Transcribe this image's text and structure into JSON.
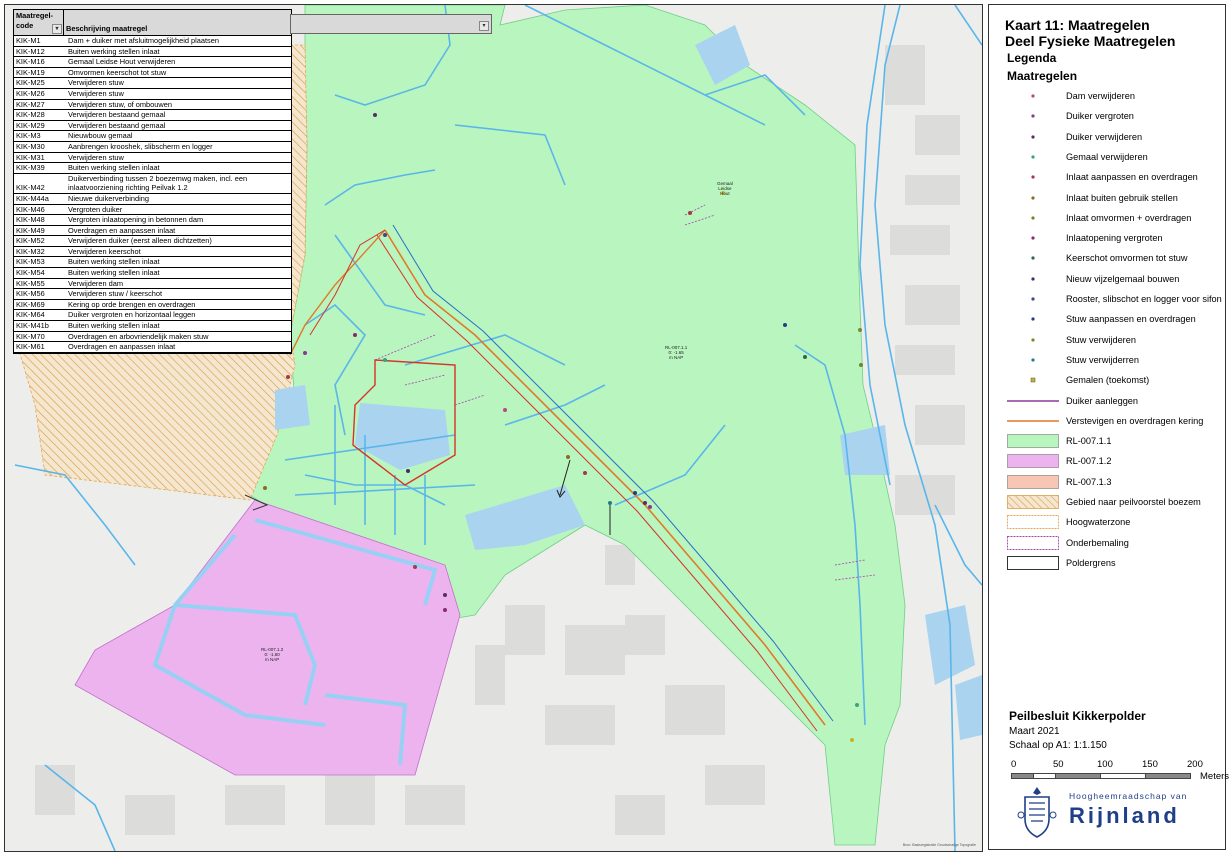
{
  "table": {
    "header_code": "Maatregel-code",
    "header_desc": "Beschrijving maatregel",
    "rows": [
      {
        "code": "KIK-M1",
        "desc": "Dam + duiker met afsluitmogelijkheid plaatsen"
      },
      {
        "code": "KIK-M12",
        "desc": "Buiten werking stellen inlaat"
      },
      {
        "code": "KIK-M16",
        "desc": "Gemaal Leidse Hout verwijderen"
      },
      {
        "code": "KIK-M19",
        "desc": "Omvormen keerschot tot stuw"
      },
      {
        "code": "KIK-M25",
        "desc": "Verwijderen stuw"
      },
      {
        "code": "KIK-M26",
        "desc": "Verwijderen stuw"
      },
      {
        "code": "KIK-M27",
        "desc": "Verwijderen stuw, of ombouwen"
      },
      {
        "code": "KIK-M28",
        "desc": "Verwijderen bestaand gemaal"
      },
      {
        "code": "KIK-M29",
        "desc": "Verwijderen bestaand gemaal"
      },
      {
        "code": "KIK-M3",
        "desc": "Nieuwbouw gemaal"
      },
      {
        "code": "KIK-M30",
        "desc": "Aanbrengen krooshek, slibscherm en logger"
      },
      {
        "code": "KIK-M31",
        "desc": "Verwijderen stuw"
      },
      {
        "code": "KIK-M39",
        "desc": "Buiten werking stellen inlaat"
      },
      {
        "code": "KIK-M42",
        "desc": "Duikerverbinding tussen 2 boezemwg maken, incl. een inlaatvoorziening richting Peilvak 1.2"
      },
      {
        "code": "KIK-M44a",
        "desc": "Nieuwe duikerverbinding"
      },
      {
        "code": "KIK-M46",
        "desc": "Vergroten duiker"
      },
      {
        "code": "KIK-M48",
        "desc": "Vergroten inlaatopening in betonnen dam"
      },
      {
        "code": "KIK-M49",
        "desc": "Overdragen en aanpassen inlaat"
      },
      {
        "code": "KIK-M52",
        "desc": "Verwijderen duiker (eerst alleen dichtzetten)"
      },
      {
        "code": "KIK-M32",
        "desc": "Verwijderen keerschot"
      },
      {
        "code": "KIK-M53",
        "desc": "Buiten werking stellen inlaat"
      },
      {
        "code": "KIK-M54",
        "desc": "Buiten werking stellen inlaat"
      },
      {
        "code": "KIK-M55",
        "desc": "Verwijderen dam"
      },
      {
        "code": "KIK-M56",
        "desc": "Verwijderen stuw / keerschot"
      },
      {
        "code": "KIK-M69",
        "desc": "Kering op orde brengen en overdragen"
      },
      {
        "code": "KIK-M64",
        "desc": "Duiker vergroten en horizontaal leggen"
      },
      {
        "code": "KIK-M41b",
        "desc": "Buiten werking stellen inlaat"
      },
      {
        "code": "KIK-M70",
        "desc": "Overdragen en arbovriendelijk maken stuw"
      },
      {
        "code": "KIK-M61",
        "desc": "Overdragen en aanpassen inlaat"
      }
    ]
  },
  "map": {
    "label_center": {
      "l1": "RL-007.1.1",
      "l2": "0: -1.65",
      "l3": "m NAP"
    },
    "label_purple": {
      "l1": "RL-007.1.2",
      "l2": "0: -1.60",
      "l3": "m NAP"
    },
    "label_gemaal": {
      "l1": "Gemaal",
      "l2": "Leidse",
      "l3": "Hout"
    },
    "credit": "Bron: Basisregistratie Grootschalige Topografie"
  },
  "legend": {
    "title_line1": "Kaart 11: Maatregelen",
    "title_line2": "Deel Fysieke Maatregelen",
    "legenda": "Legenda",
    "maatregelen": "Maatregelen",
    "items": [
      {
        "label": "Dam verwijderen",
        "kind": "dot",
        "color": "#b84a7c"
      },
      {
        "label": "Duiker vergroten",
        "kind": "dot",
        "color": "#8a3a8f"
      },
      {
        "label": "Duiker verwijderen",
        "kind": "dot",
        "color": "#5a2d6a"
      },
      {
        "label": "Gemaal verwijderen",
        "kind": "dot",
        "color": "#3aa37a"
      },
      {
        "label": "Inlaat aanpassen en overdragen",
        "kind": "dot",
        "color": "#a33a4a"
      },
      {
        "label": "Inlaat buiten gebruik stellen",
        "kind": "dot",
        "color": "#8a6a2a"
      },
      {
        "label": "Inlaat omvormen + overdragen",
        "kind": "dot",
        "color": "#6a8a2a"
      },
      {
        "label": "Inlaatopening vergroten",
        "kind": "dot",
        "color": "#8a2a6a"
      },
      {
        "label": "Keerschot omvormen tot stuw",
        "kind": "dot",
        "color": "#2a6a4a"
      },
      {
        "label": "Nieuw vijzelgemaal bouwen",
        "kind": "dot",
        "color": "#4a2a6a"
      },
      {
        "label": "Rooster, slibschot en logger voor sifon",
        "kind": "dot",
        "color": "#3a4a8a"
      },
      {
        "label": "Stuw aanpassen en overdragen",
        "kind": "dot",
        "color": "#2a3a8a"
      },
      {
        "label": "Stuw verwijderen",
        "kind": "dot",
        "color": "#7a8a2a"
      },
      {
        "label": "Stuw verwijderren",
        "kind": "dot",
        "color": "#2a7a8a"
      },
      {
        "label": "Gemalen (toekomst)",
        "kind": "square",
        "color": "#c9b22a"
      },
      {
        "label": "Duiker aanleggen",
        "kind": "line",
        "color": "#8a3a9a"
      },
      {
        "label": "Verstevigen en overdragen kering",
        "kind": "line",
        "color": "#e07a2a"
      },
      {
        "label": "RL-007.1.1",
        "kind": "fill",
        "color": "#b9f5bf"
      },
      {
        "label": "RL-007.1.2",
        "kind": "fill",
        "color": "#ecb3ef"
      },
      {
        "label": "RL-007.1.3",
        "kind": "fill",
        "color": "#f8c6b4"
      },
      {
        "label": "Gebied naar peilvoorstel boezem",
        "kind": "hatch",
        "color": "#d9a14a"
      },
      {
        "label": "Hoogwaterzone",
        "kind": "dashbox",
        "color": "#e8a650"
      },
      {
        "label": "Onderbemaling",
        "kind": "dashbox",
        "color": "#a840b0"
      },
      {
        "label": "Poldergrens",
        "kind": "box",
        "color": "#333333"
      }
    ],
    "bottom_title": "Peilbesluit Kikkerpolder",
    "date": "Maart 2021",
    "scale": "Schaal op A1: 1:1.150",
    "scale_labels": [
      "0",
      "50",
      "100",
      "150",
      "200"
    ],
    "scale_unit": "Meters",
    "logo_top": "Hoogheemraadschap van",
    "logo_name": "Rijnland"
  },
  "colors": {
    "green_area": "#b9f5bf",
    "purple_area": "#ecb3ef",
    "water": "#aad3f0",
    "water_line": "#5ab6ea",
    "kering": "#e07a2a",
    "red_line": "#d8322a"
  }
}
